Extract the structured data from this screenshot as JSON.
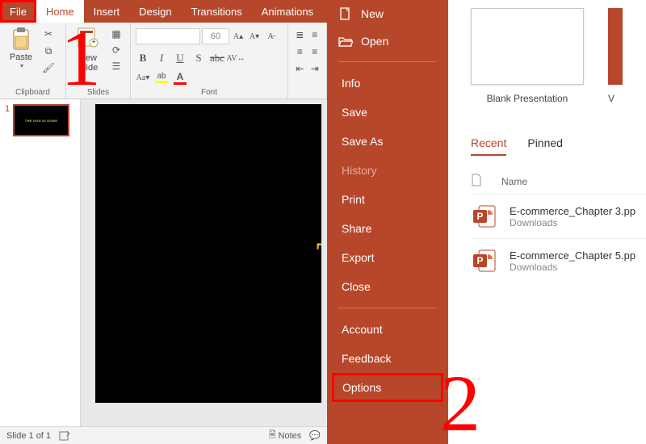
{
  "tabs": {
    "file": "File",
    "home": "Home",
    "insert": "Insert",
    "design": "Design",
    "transitions": "Transitions",
    "animations": "Animations"
  },
  "ribbon": {
    "clipboard": {
      "paste": "Paste",
      "label": "Clipboard"
    },
    "slides": {
      "newslide": "New\nSlide",
      "label": "Slides"
    },
    "font": {
      "size": "60",
      "label": "Font"
    }
  },
  "slide": {
    "title": "THẾ G",
    "thumb_title": "THE GIOI DI DONG"
  },
  "status": {
    "counter": "Slide 1 of 1",
    "notes": "Notes"
  },
  "annotations": {
    "one": "1",
    "two": "2"
  },
  "backstage": {
    "new": "New",
    "open": "Open",
    "info": "Info",
    "save": "Save",
    "saveas": "Save As",
    "history": "History",
    "print": "Print",
    "share": "Share",
    "export": "Export",
    "close": "Close",
    "account": "Account",
    "feedback": "Feedback",
    "options": "Options"
  },
  "start": {
    "blank": "Blank Presentation",
    "tabs": {
      "recent": "Recent",
      "pinned": "Pinned"
    },
    "name_col": "Name",
    "files": [
      {
        "name": "E-commerce_Chapter 3.pp",
        "loc": "Downloads"
      },
      {
        "name": "E-commerce_Chapter 5.pp",
        "loc": "Downloads"
      }
    ]
  }
}
